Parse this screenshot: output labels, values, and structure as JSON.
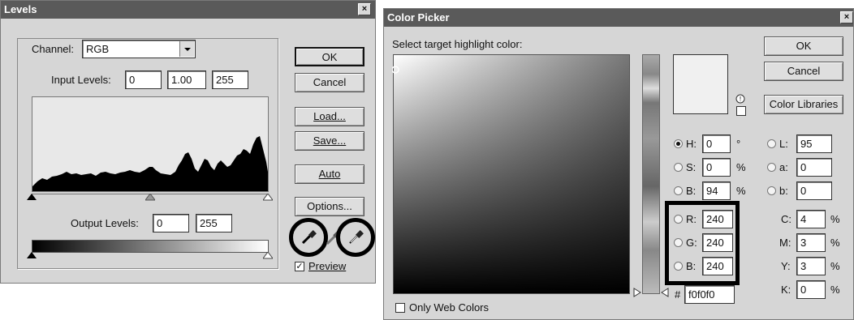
{
  "levels": {
    "title": "Levels",
    "channel_label": "Channel:",
    "channel_value": "RGB",
    "input_levels_label": "Input Levels:",
    "input_levels": [
      "0",
      "1.00",
      "255"
    ],
    "output_levels_label": "Output Levels:",
    "output_levels": [
      "0",
      "255"
    ],
    "buttons": {
      "ok": "OK",
      "cancel": "Cancel",
      "load": "Load...",
      "save": "Save...",
      "auto": "Auto",
      "options": "Options..."
    },
    "preview_label": "Preview",
    "preview_checked": true,
    "close_glyph": "×"
  },
  "picker": {
    "title": "Color Picker",
    "prompt": "Select target highlight color:",
    "buttons": {
      "ok": "OK",
      "cancel": "Cancel",
      "libraries": "Color Libraries"
    },
    "hsb": [
      {
        "label": "H:",
        "value": "0",
        "unit": "°"
      },
      {
        "label": "S:",
        "value": "0",
        "unit": "%"
      },
      {
        "label": "B:",
        "value": "94",
        "unit": "%"
      }
    ],
    "lab": [
      {
        "label": "L:",
        "value": "95"
      },
      {
        "label": "a:",
        "value": "0"
      },
      {
        "label": "b:",
        "value": "0"
      }
    ],
    "rgb": [
      {
        "label": "R:",
        "value": "240"
      },
      {
        "label": "G:",
        "value": "240"
      },
      {
        "label": "B:",
        "value": "240"
      }
    ],
    "cmyk": [
      {
        "label": "C:",
        "value": "4",
        "unit": "%"
      },
      {
        "label": "M:",
        "value": "3",
        "unit": "%"
      },
      {
        "label": "Y:",
        "value": "3",
        "unit": "%"
      },
      {
        "label": "K:",
        "value": "0",
        "unit": "%"
      }
    ],
    "hex_label": "#",
    "hex_value": "f0f0f0",
    "web_colors_label": "Only Web Colors",
    "web_colors_checked": false,
    "selected_radio": "H",
    "swatch_color": "#f0f0f0",
    "close_glyph": "×"
  },
  "icons": [
    "dropdown-arrow-icon",
    "eyedropper-icon",
    "gamut-warning-icon",
    "web-safe-cube-icon",
    "slider-triangle-icon"
  ]
}
